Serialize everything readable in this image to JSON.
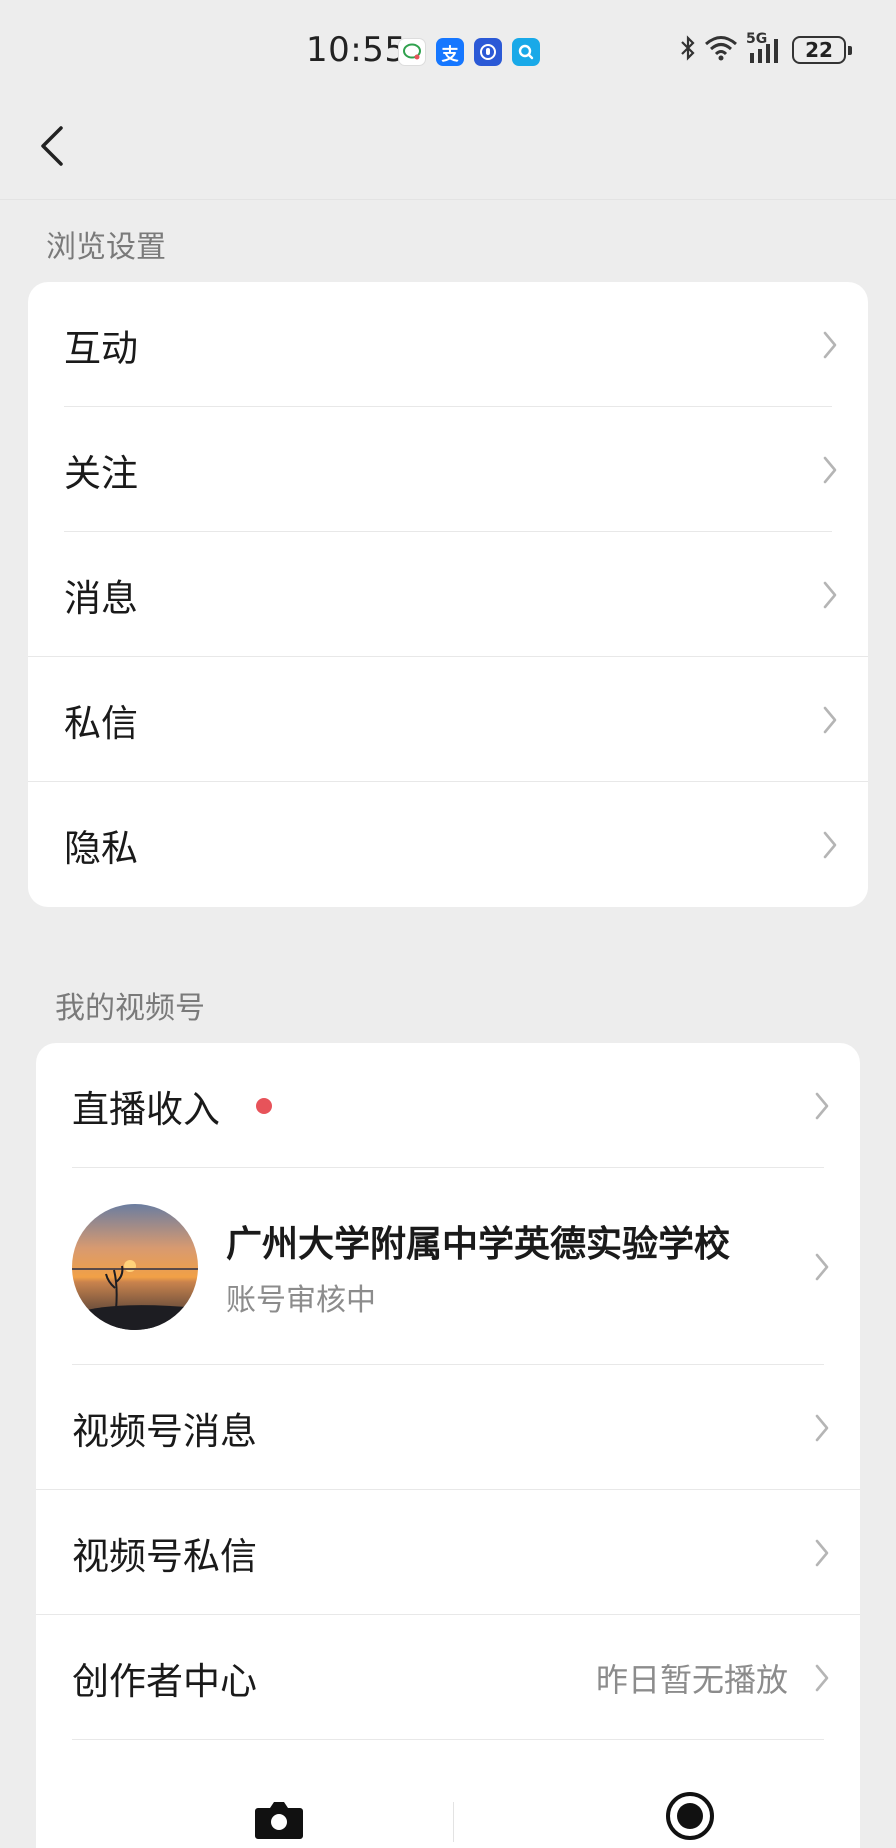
{
  "status_bar": {
    "time": "10:55",
    "battery": "22",
    "network": "5G",
    "app_icons": [
      "bubble-icon",
      "alipay-icon",
      "hand-icon",
      "search-app-icon"
    ]
  },
  "nav": {
    "back_icon": "chevron-left-icon"
  },
  "browse_settings": {
    "title": "浏览设置",
    "items": [
      {
        "label": "互动"
      },
      {
        "label": "关注"
      },
      {
        "label": "消息"
      },
      {
        "label": "私信"
      },
      {
        "label": "隐私"
      }
    ]
  },
  "channels": {
    "title": "我的视频号",
    "live_income": {
      "label": "直播收入",
      "badge": "red-dot"
    },
    "profile": {
      "name": "广州大学附属中学英德实验学校",
      "status": "账号审核中"
    },
    "items": [
      {
        "label": "视频号消息"
      },
      {
        "label": "视频号私信"
      }
    ],
    "creator_center": {
      "label": "创作者中心",
      "value": "昨日暂无播放"
    },
    "actions": [
      "camera-icon",
      "record-icon"
    ]
  },
  "colors": {
    "background": "#ededed",
    "card": "#ffffff",
    "badge_red": "#e7535a",
    "secondary_text": "#8c8c8c"
  }
}
